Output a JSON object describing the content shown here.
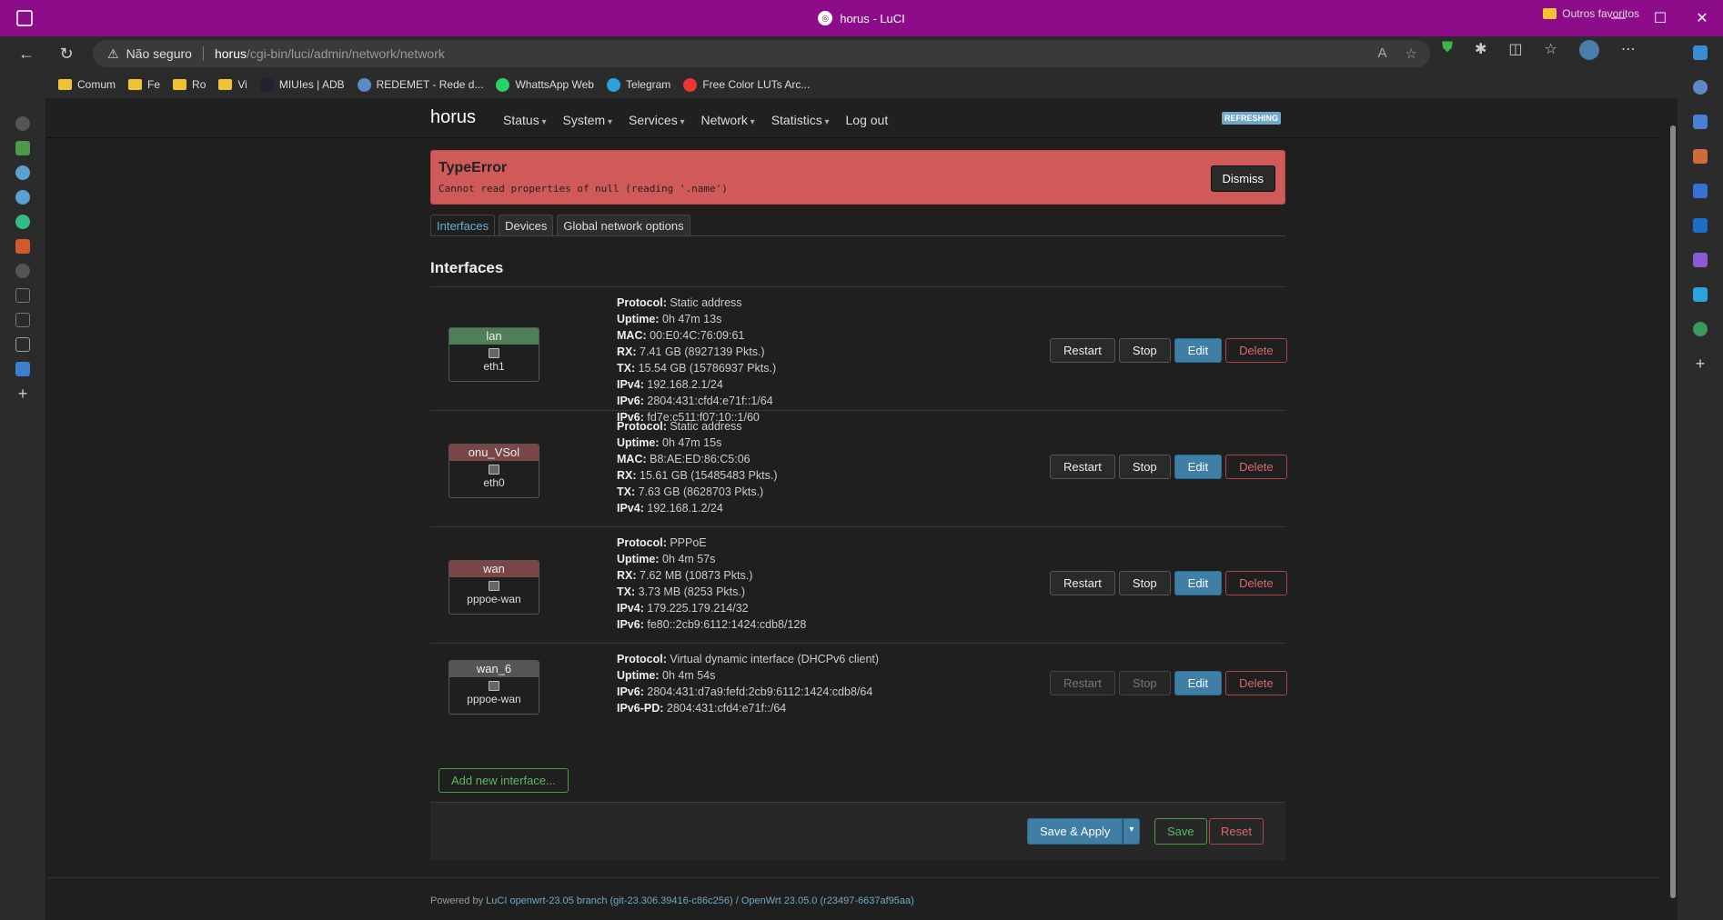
{
  "browser": {
    "window_title": "horus - LuCI",
    "security_label": "Não seguro",
    "url_host": "horus",
    "url_path": "/cgi-bin/luci/admin/network/network",
    "bookmarks": [
      {
        "label": "Comum",
        "icon": "folder-icon"
      },
      {
        "label": "Fe",
        "icon": "folder-icon"
      },
      {
        "label": "Ro",
        "icon": "folder-icon"
      },
      {
        "label": "Vi",
        "icon": "folder-icon"
      },
      {
        "label": "MIUIes | ADB",
        "icon": "miui-icon"
      },
      {
        "label": "REDEMET - Rede d...",
        "icon": "redemet-icon"
      },
      {
        "label": "WhattsApp Web",
        "icon": "whatsapp-icon"
      },
      {
        "label": "Telegram",
        "icon": "telegram-icon"
      },
      {
        "label": "Free Color LUTs Arc...",
        "icon": "youtube-icon"
      }
    ],
    "other_favorites": "Outros favoritos"
  },
  "luci": {
    "brand": "horus",
    "menu": [
      "Status",
      "System",
      "Services",
      "Network",
      "Statistics",
      "Log out"
    ],
    "refresh_badge": "REFRESHING",
    "alert": {
      "title": "TypeError",
      "message": "Cannot read properties of null (reading '.name')",
      "dismiss": "Dismiss"
    },
    "tabs": [
      "Interfaces",
      "Devices",
      "Global network options"
    ],
    "section_title": "Interfaces",
    "interfaces": [
      {
        "name": "lan",
        "device": "eth1",
        "color": "#4f7f57",
        "lines": [
          {
            "k": "Protocol:",
            "v": "Static address"
          },
          {
            "k": "Uptime:",
            "v": "0h 47m 13s"
          },
          {
            "k": "MAC:",
            "v": "00:E0:4C:76:09:61"
          },
          {
            "k": "RX:",
            "v": "7.41 GB (8927139 Pkts.)"
          },
          {
            "k": "TX:",
            "v": "15.54 GB (15786937 Pkts.)"
          },
          {
            "k": "IPv4:",
            "v": "192.168.2.1/24"
          },
          {
            "k": "IPv6:",
            "v": "2804:431:cfd4:e71f::1/64"
          },
          {
            "k": "IPv6:",
            "v": "fd7e:c511:f07:10::1/60"
          }
        ]
      },
      {
        "name": "onu_VSol",
        "device": "eth0",
        "color": "#7a4646",
        "lines": [
          {
            "k": "Protocol:",
            "v": "Static address"
          },
          {
            "k": "Uptime:",
            "v": "0h 47m 15s"
          },
          {
            "k": "MAC:",
            "v": "B8:AE:ED:86:C5:06"
          },
          {
            "k": "RX:",
            "v": "15.61 GB (15485483 Pkts.)"
          },
          {
            "k": "TX:",
            "v": "7.63 GB (8628703 Pkts.)"
          },
          {
            "k": "IPv4:",
            "v": "192.168.1.2/24"
          }
        ]
      },
      {
        "name": "wan",
        "device": "pppoe-wan",
        "color": "#7a4646",
        "lines": [
          {
            "k": "Protocol:",
            "v": "PPPoE"
          },
          {
            "k": "Uptime:",
            "v": "0h 4m 57s"
          },
          {
            "k": "RX:",
            "v": "7.62 MB (10873 Pkts.)"
          },
          {
            "k": "TX:",
            "v": "3.73 MB (8253 Pkts.)"
          },
          {
            "k": "IPv4:",
            "v": "179.225.179.214/32"
          },
          {
            "k": "IPv6:",
            "v": "fe80::2cb9:6112:1424:cdb8/128"
          }
        ]
      },
      {
        "name": "wan_6",
        "device": "pppoe-wan",
        "color": "#555555",
        "lines": [
          {
            "k": "Protocol:",
            "v": "Virtual dynamic interface (DHCPv6 client)"
          },
          {
            "k": "Uptime:",
            "v": "0h 4m 54s"
          },
          {
            "k": "IPv6:",
            "v": "2804:431:d7a9:fefd:2cb9:6112:1424:cdb8/64"
          },
          {
            "k": "IPv6-PD:",
            "v": "2804:431:cfd4:e71f::/64"
          }
        ]
      }
    ],
    "row_buttons": {
      "restart": "Restart",
      "stop": "Stop",
      "edit": "Edit",
      "delete": "Delete"
    },
    "add_interface": "Add new interface...",
    "save_apply": "Save & Apply",
    "save": "Save",
    "reset": "Reset",
    "footer": {
      "powered_by": "Powered by ",
      "luci_link": "LuCI openwrt-23.05 branch (git-23.306.39416-c86c256)",
      "sep": " / ",
      "openwrt_link": "OpenWrt 23.05.0 (r23497-6637af95aa)"
    }
  }
}
